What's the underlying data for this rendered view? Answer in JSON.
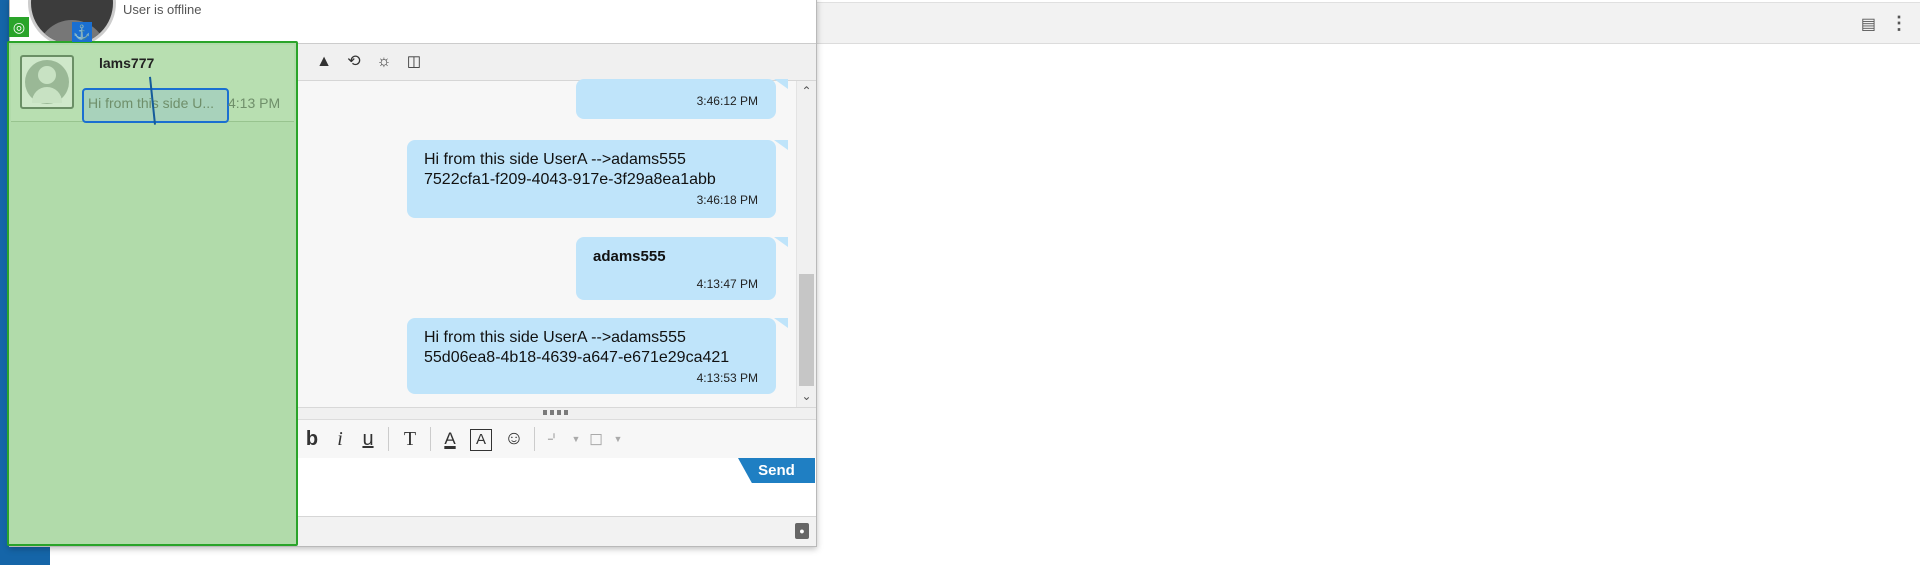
{
  "colors": {
    "accent": "#1f7fc3",
    "bubble": "#bfe4fa",
    "overlay_fill": "#b1dbaa",
    "overlay_border": "#2aa42a",
    "highlight": "#1a6fd1"
  },
  "header": {
    "status": "User is offline"
  },
  "toolbar": {
    "icons": [
      "org-chart-icon",
      "history-icon",
      "add-contact-icon",
      "video-icon"
    ]
  },
  "contact": {
    "name_fragment": "lams777",
    "preview": "Hi from this side U...",
    "time": "4:13 PM"
  },
  "messages": [
    {
      "text_line1": "",
      "text_line2": "",
      "time": "3:46:12 PM"
    },
    {
      "text_line1": "Hi from this side UserA -->adams555",
      "text_line2": "7522cfa1-f209-4043-917e-3f29a8ea1abb",
      "time": "3:46:18 PM"
    },
    {
      "sender": "adams555",
      "time": "4:13:47 PM"
    },
    {
      "text_line1": "Hi from this side UserA -->adams555",
      "text_line2": "55d06ea8-4b18-4639-a647-e671e29ca421",
      "time": "4:13:53 PM"
    }
  ],
  "format_bar": {
    "bold": "b",
    "italic": "i",
    "underline": "u",
    "font_size": "T",
    "font_color": "A",
    "highlight": "A"
  },
  "send": {
    "label": "Send"
  }
}
